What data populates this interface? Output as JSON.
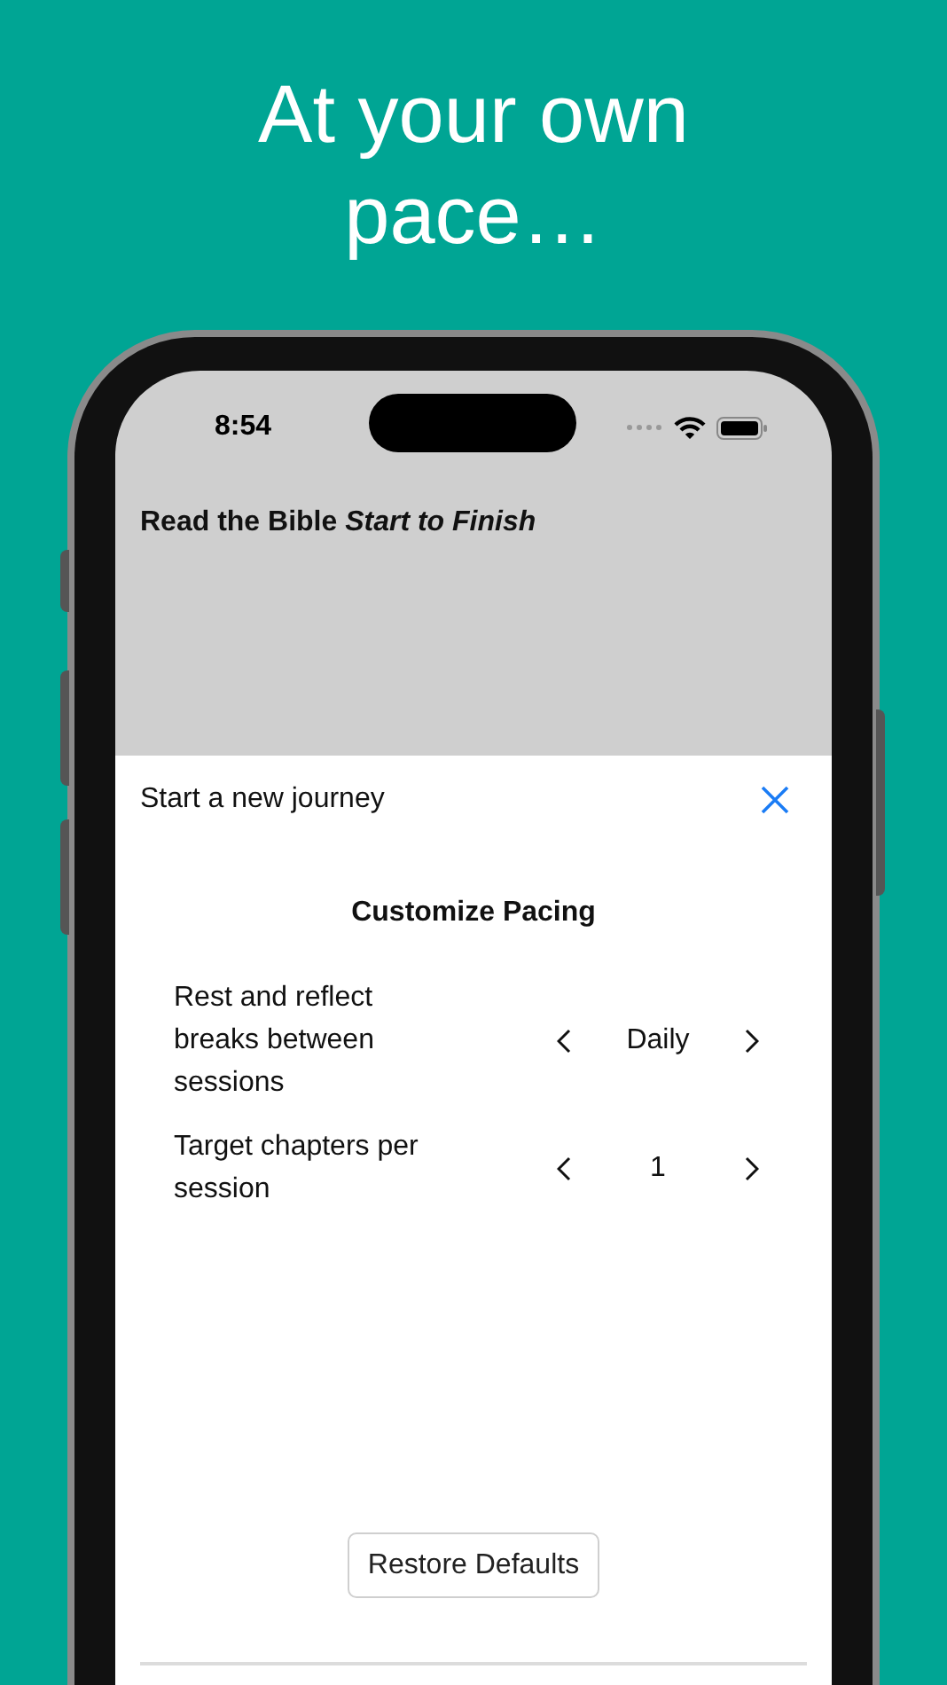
{
  "headline": "At your own pace…",
  "status_bar": {
    "time": "8:54"
  },
  "app_title": "Read the Bible *Start to Finish*",
  "sheet": {
    "title": "Start a new journey",
    "section_title": "Customize Pacing",
    "settings": [
      {
        "label": "Rest and reflect breaks between sessions",
        "value": "Daily"
      },
      {
        "label": "Target chapters per session",
        "value": "1"
      }
    ],
    "restore_button": "Restore Defaults"
  }
}
